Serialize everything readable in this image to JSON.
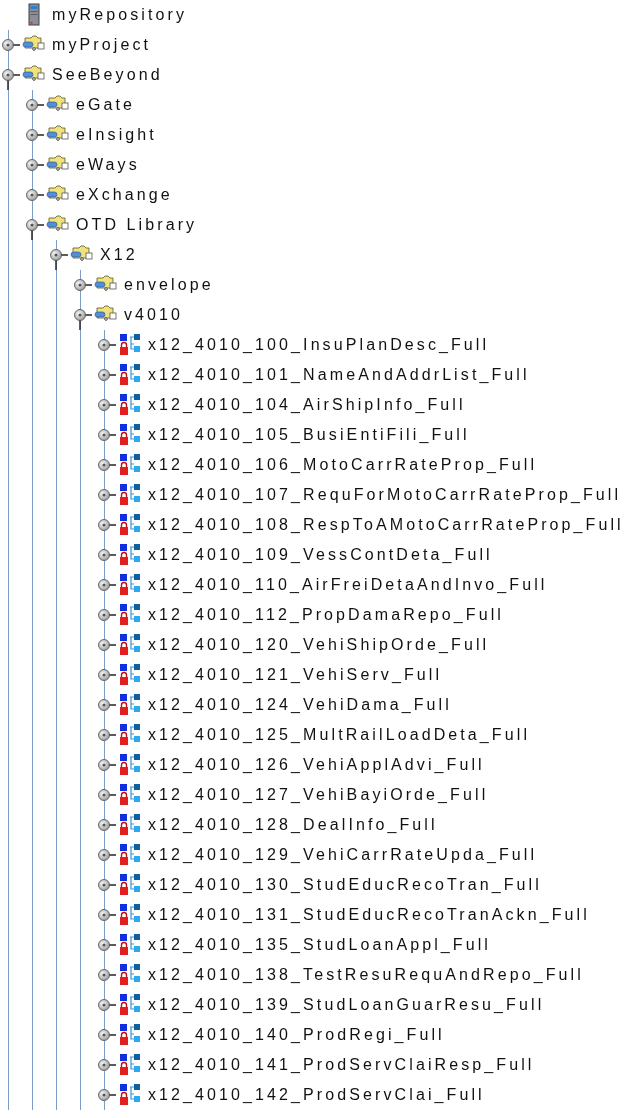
{
  "tree": {
    "label": "myRepository",
    "kind": "repository",
    "children": [
      {
        "label": "myProject",
        "kind": "project",
        "expanded": false
      },
      {
        "label": "SeeBeyond",
        "kind": "project",
        "expanded": true,
        "children": [
          {
            "label": "eGate",
            "kind": "project",
            "expanded": false
          },
          {
            "label": "eInsight",
            "kind": "project",
            "expanded": false
          },
          {
            "label": "eWays",
            "kind": "project",
            "expanded": false
          },
          {
            "label": "eXchange",
            "kind": "project",
            "expanded": false
          },
          {
            "label": "OTD Library",
            "kind": "project",
            "expanded": true,
            "children": [
              {
                "label": "X12",
                "kind": "project",
                "expanded": true,
                "children": [
                  {
                    "label": "envelope",
                    "kind": "project",
                    "expanded": false
                  },
                  {
                    "label": "v4010",
                    "kind": "project",
                    "expanded": true,
                    "children": [
                      {
                        "label": "x12_4010_100_InsuPlanDesc_Full",
                        "kind": "otd",
                        "expanded": false
                      },
                      {
                        "label": "x12_4010_101_NameAndAddrList_Full",
                        "kind": "otd",
                        "expanded": false
                      },
                      {
                        "label": "x12_4010_104_AirShipInfo_Full",
                        "kind": "otd",
                        "expanded": false
                      },
                      {
                        "label": "x12_4010_105_BusiEntiFili_Full",
                        "kind": "otd",
                        "expanded": false
                      },
                      {
                        "label": "x12_4010_106_MotoCarrRateProp_Full",
                        "kind": "otd",
                        "expanded": false
                      },
                      {
                        "label": "x12_4010_107_RequForMotoCarrRateProp_Full",
                        "kind": "otd",
                        "expanded": false
                      },
                      {
                        "label": "x12_4010_108_RespToAMotoCarrRateProp_Full",
                        "kind": "otd",
                        "expanded": false
                      },
                      {
                        "label": "x12_4010_109_VessContDeta_Full",
                        "kind": "otd",
                        "expanded": false
                      },
                      {
                        "label": "x12_4010_110_AirFreiDetaAndInvo_Full",
                        "kind": "otd",
                        "expanded": false
                      },
                      {
                        "label": "x12_4010_112_PropDamaRepo_Full",
                        "kind": "otd",
                        "expanded": false
                      },
                      {
                        "label": "x12_4010_120_VehiShipOrde_Full",
                        "kind": "otd",
                        "expanded": false
                      },
                      {
                        "label": "x12_4010_121_VehiServ_Full",
                        "kind": "otd",
                        "expanded": false
                      },
                      {
                        "label": "x12_4010_124_VehiDama_Full",
                        "kind": "otd",
                        "expanded": false
                      },
                      {
                        "label": "x12_4010_125_MultRailLoadDeta_Full",
                        "kind": "otd",
                        "expanded": false
                      },
                      {
                        "label": "x12_4010_126_VehiApplAdvi_Full",
                        "kind": "otd",
                        "expanded": false
                      },
                      {
                        "label": "x12_4010_127_VehiBayiOrde_Full",
                        "kind": "otd",
                        "expanded": false
                      },
                      {
                        "label": "x12_4010_128_DealInfo_Full",
                        "kind": "otd",
                        "expanded": false
                      },
                      {
                        "label": "x12_4010_129_VehiCarrRateUpda_Full",
                        "kind": "otd",
                        "expanded": false
                      },
                      {
                        "label": "x12_4010_130_StudEducRecoTran_Full",
                        "kind": "otd",
                        "expanded": false
                      },
                      {
                        "label": "x12_4010_131_StudEducRecoTranAckn_Full",
                        "kind": "otd",
                        "expanded": false
                      },
                      {
                        "label": "x12_4010_135_StudLoanAppl_Full",
                        "kind": "otd",
                        "expanded": false
                      },
                      {
                        "label": "x12_4010_138_TestResuRequAndRepo_Full",
                        "kind": "otd",
                        "expanded": false
                      },
                      {
                        "label": "x12_4010_139_StudLoanGuarResu_Full",
                        "kind": "otd",
                        "expanded": false
                      },
                      {
                        "label": "x12_4010_140_ProdRegi_Full",
                        "kind": "otd",
                        "expanded": false
                      },
                      {
                        "label": "x12_4010_141_ProdServClaiResp_Full",
                        "kind": "otd",
                        "expanded": false
                      },
                      {
                        "label": "x12_4010_142_ProdServClai_Full",
                        "kind": "otd",
                        "expanded": false
                      }
                    ]
                  }
                ]
              }
            ]
          }
        ]
      }
    ]
  }
}
